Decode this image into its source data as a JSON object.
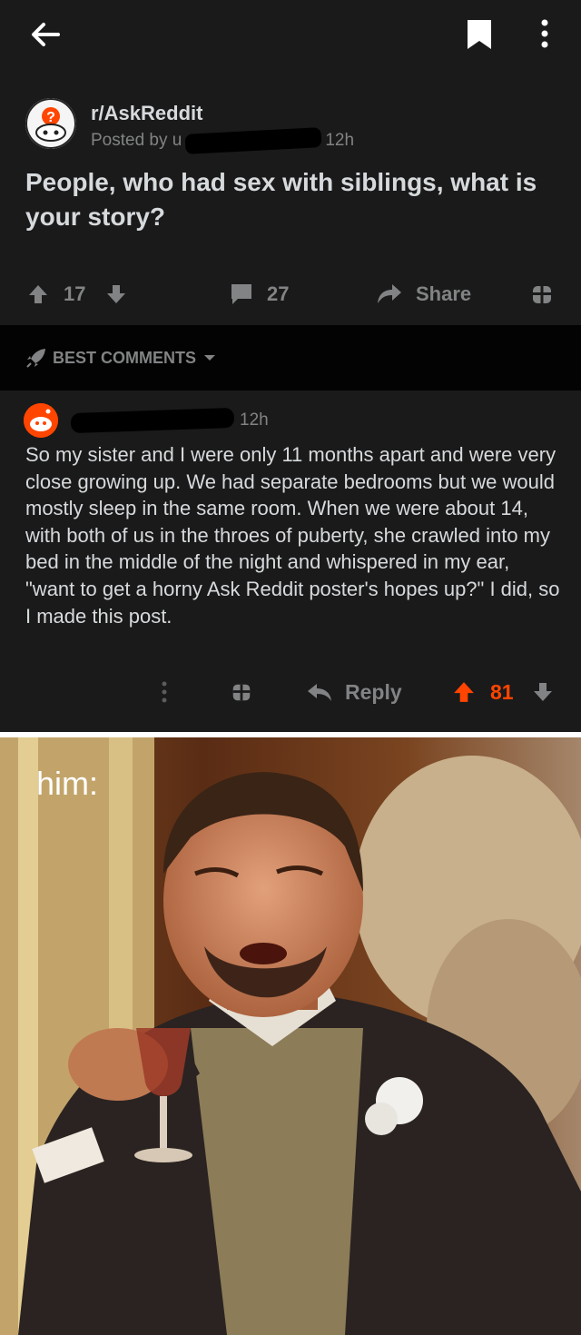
{
  "post": {
    "subreddit": "r/AskReddit",
    "posted_by": "Posted by u",
    "age": "12h",
    "title": "People, who had sex with siblings, what is your story?",
    "upvotes": "17",
    "comments": "27",
    "share_label": "Share"
  },
  "sort": {
    "label": "BEST COMMENTS"
  },
  "comment": {
    "age": "12h",
    "body": "So my sister and I were only 11 months apart and were very close growing up. We had separate bedrooms but we would mostly sleep in the same room. When we were about 14, with both of us in the throes of puberty, she crawled into my bed in the middle of the night and whispered in my ear, \"want to get a horny Ask Reddit poster's hopes up?\" I did, so I made this post.",
    "reply_label": "Reply",
    "score": "81"
  },
  "meme": {
    "caption": "him:"
  },
  "colors": {
    "accent": "#ff4500",
    "bg": "#1a1a1b",
    "muted": "#818384"
  }
}
